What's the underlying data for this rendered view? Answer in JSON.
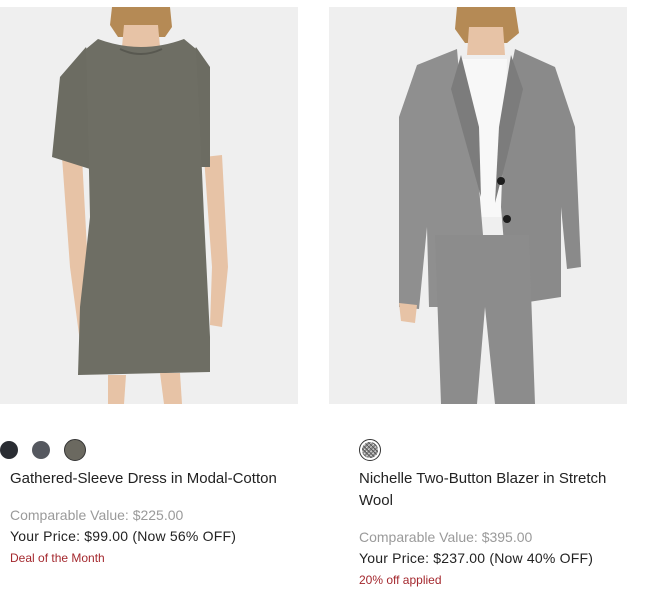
{
  "products": [
    {
      "name": "Gathered-Sleeve Dress in Modal-Cotton",
      "comparable": "Comparable Value: $225.00",
      "price": "Your Price: $99.00 (Now 56% OFF)",
      "promo": "Deal of the Month",
      "swatches": [
        {
          "color": "#2a2d33",
          "name": "dark-navy",
          "selected": false
        },
        {
          "color": "#55585f",
          "name": "slate-gray",
          "selected": false
        },
        {
          "color": "#6b6960",
          "name": "olive-gray",
          "selected": true
        }
      ]
    },
    {
      "name": "Nichelle Two-Button Blazer in Stretch Wool",
      "comparable": "Comparable Value: $395.00",
      "price": "Your Price: $237.00 (Now 40% OFF)",
      "promo": "20% off applied",
      "swatches": [
        {
          "color": "#8a8a8a",
          "name": "houndstooth",
          "selected": true
        }
      ]
    }
  ],
  "colors": {
    "promo": "#a4282e",
    "comparable": "#9a9a9a",
    "photo_bg": "#efefef"
  }
}
